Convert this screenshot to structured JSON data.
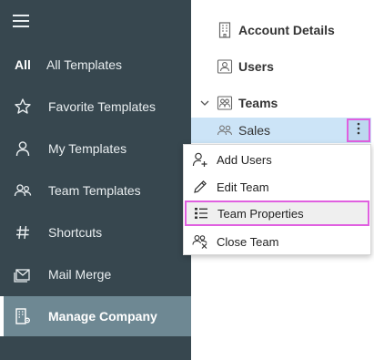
{
  "sidebar": {
    "items": [
      {
        "label": "All Templates",
        "icon": "all-text-icon",
        "icon_text": "All"
      },
      {
        "label": "Favorite Templates",
        "icon": "star-icon"
      },
      {
        "label": "My Templates",
        "icon": "person-icon"
      },
      {
        "label": "Team Templates",
        "icon": "people-icon"
      },
      {
        "label": "Shortcuts",
        "icon": "hash-icon"
      },
      {
        "label": "Mail Merge",
        "icon": "mail-merge-icon"
      },
      {
        "label": "Manage Company",
        "icon": "building-settings-icon",
        "active": true
      }
    ]
  },
  "tree": {
    "account_details": "Account Details",
    "users": "Users",
    "teams": "Teams",
    "sales": "Sales"
  },
  "context_menu": {
    "items": [
      {
        "label": "Add Users",
        "icon": "person-add-icon"
      },
      {
        "label": "Edit Team",
        "icon": "pencil-icon"
      },
      {
        "label": "Team Properties",
        "icon": "list-icon",
        "highlighted": true
      },
      {
        "label": "Close Team",
        "icon": "people-close-icon"
      }
    ]
  },
  "colors": {
    "sidebar_bg": "#37474f",
    "active_bg": "#6e8893",
    "selection_bg": "#cce4f7",
    "highlight_border": "#e060e0"
  }
}
